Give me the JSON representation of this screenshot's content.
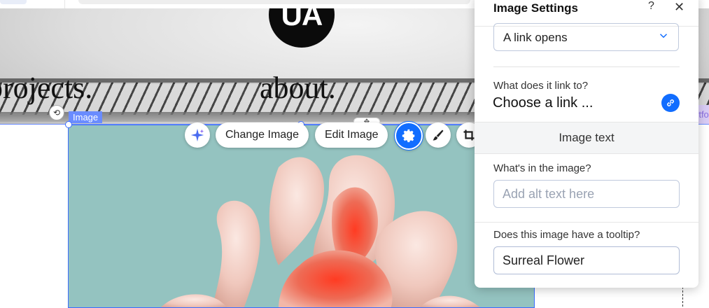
{
  "page": {
    "nav_projects": "projects.",
    "nav_about": "about.",
    "logo_text": "UA",
    "right_edge_chip": "rtfo"
  },
  "canvas": {
    "selected_element_label": "Image",
    "image_description": "pink surreal flower sculpture on teal background"
  },
  "toolbar": {
    "ai_icon": "sparkle-icon",
    "change_image_label": "Change Image",
    "edit_image_label": "Edit Image",
    "settings_icon": "gear-icon",
    "design_icon": "brush-icon",
    "crop_icon": "crop-icon"
  },
  "panel": {
    "title": "Image Settings",
    "help_glyph": "?",
    "close_glyph": "✕",
    "link_behavior": {
      "selected": "A link opens"
    },
    "link_to": {
      "label": "What does it link to?",
      "value": "Choose a link ..."
    },
    "section_image_text": "Image text",
    "alt_text": {
      "label": "What's in the image?",
      "placeholder": "Add alt text here",
      "value": ""
    },
    "tooltip": {
      "label": "Does this image have a tooltip?",
      "value": "Surreal Flower"
    }
  },
  "colors": {
    "accent_blue": "#116dff",
    "selection_blue": "#6a8cff",
    "image_background": "#94c3c0",
    "flower_pink": "#f0c8bd",
    "flower_red": "#ee4b35"
  }
}
